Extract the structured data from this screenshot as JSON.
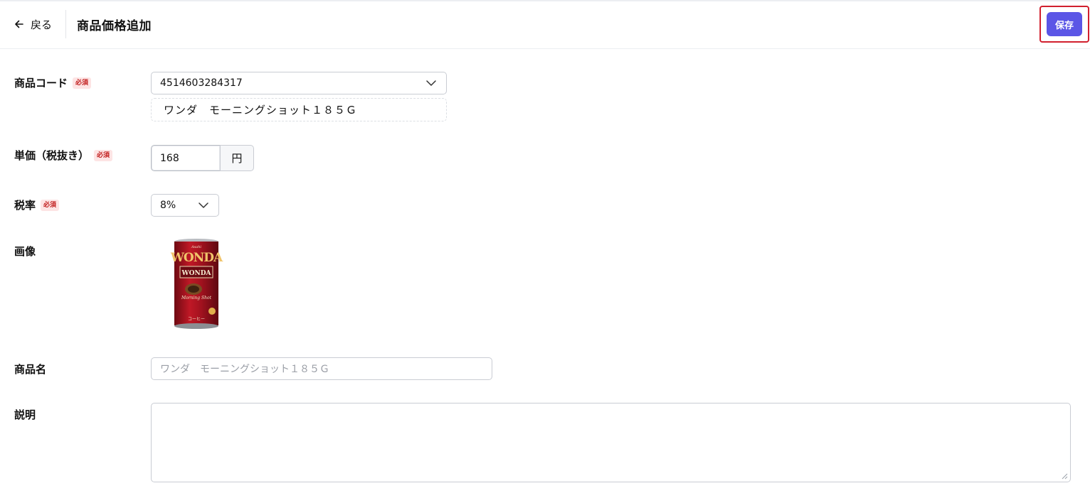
{
  "header": {
    "back_label": "戻る",
    "title": "商品価格追加",
    "save_label": "保存"
  },
  "form": {
    "product_code": {
      "label": "商品コード",
      "required": "必須",
      "value": "4514603284317",
      "resolved_name": "ワンダ　モーニングショット１８５Ｇ"
    },
    "unit_price": {
      "label": "単価（税抜き）",
      "required": "必須",
      "value": "168",
      "unit": "円"
    },
    "tax_rate": {
      "label": "税率",
      "required": "必須",
      "value": "8%"
    },
    "image": {
      "label": "画像",
      "can_brand": "WONDA",
      "can_maker": "Asahi",
      "can_subtitle": "Morning Shot",
      "can_type": "コーヒー"
    },
    "product_name": {
      "label": "商品名",
      "placeholder": "ワンダ　モーニングショット１８５Ｇ"
    },
    "description": {
      "label": "説明",
      "value": ""
    }
  },
  "colors": {
    "accent": "#5b56e6",
    "highlight_border": "#d11f2e",
    "required_bg": "#fde4e4",
    "required_text": "#c11b1b"
  },
  "icons": {
    "back": "arrow-left-icon",
    "dropdown": "chevron-down-icon"
  }
}
